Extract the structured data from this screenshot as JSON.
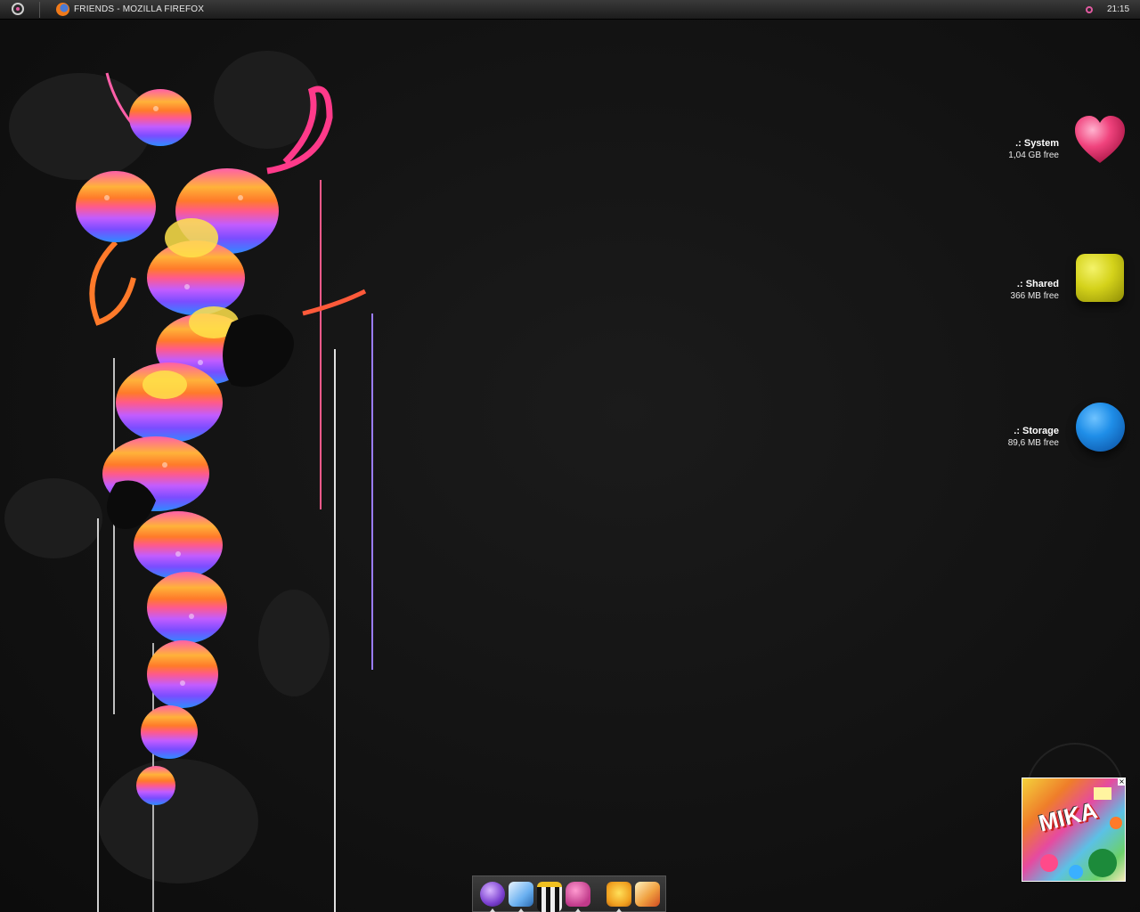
{
  "taskbar": {
    "window_title": "FRIENDS - MOZILLA FIREFOX",
    "clock": "21:15"
  },
  "drives": [
    {
      "name": ".: System",
      "free": "1,04 GB free",
      "icon": "pink-heart-icon",
      "color": "#e8437a"
    },
    {
      "name": ".: Shared",
      "free": "366 MB free",
      "icon": "yellow-cube-icon",
      "color": "#d4d21a"
    },
    {
      "name": ".: Storage",
      "free": "89,6 MB free",
      "icon": "blue-ball-icon",
      "color": "#1f8ee8"
    }
  ],
  "now_playing": {
    "album_art_text": "MIKA"
  },
  "dock": {
    "items": [
      {
        "icon": "compass-browser-icon",
        "running": true
      },
      {
        "icon": "image-preview-icon",
        "running": true
      },
      {
        "icon": "clapperboard-icon",
        "running": false
      },
      {
        "icon": "backpack-icon",
        "running": true
      },
      {
        "icon": "maple-leaf-icon",
        "running": true
      },
      {
        "icon": "photo-stack-icon",
        "running": false
      }
    ]
  }
}
